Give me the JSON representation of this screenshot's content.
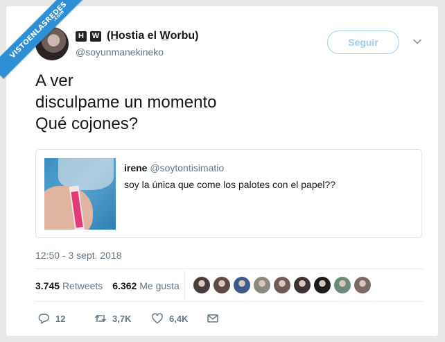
{
  "watermark": {
    "text": "VISTOENLASREDES",
    "suffix": ".com"
  },
  "author": {
    "emoji_left": "H",
    "emoji_right": "W",
    "display_name": "(H̲ostia el W̲orbu)",
    "handle": "@soyunmanekineko"
  },
  "follow_label": "Seguir",
  "tweet_lines": [
    "A ver",
    "disculpame un momento",
    "Qué cojones?"
  ],
  "quote": {
    "name": "irene",
    "handle": "@soytontisimatio",
    "text": "soy la única que come los palotes con el papel??"
  },
  "timestamp": "12:50 - 3 sept. 2018",
  "stats": {
    "retweets_count": "3.745",
    "retweets_label": "Retweets",
    "likes_count": "6.362",
    "likes_label": "Me gusta"
  },
  "liker_colors": [
    "#4a3b3c",
    "#5e4a44",
    "#3d5a8a",
    "#8b8a80",
    "#6f5b55",
    "#3a3233",
    "#1c1c1c",
    "#6b8a78",
    "#7a6a60"
  ],
  "actions": {
    "reply_count": "12",
    "retweet_count": "3,7K",
    "like_count": "6,4K"
  },
  "icons": {
    "reply": "reply-icon",
    "retweet": "retweet-icon",
    "like": "heart-icon",
    "dm": "envelope-icon",
    "menu": "chevron-down-icon"
  }
}
